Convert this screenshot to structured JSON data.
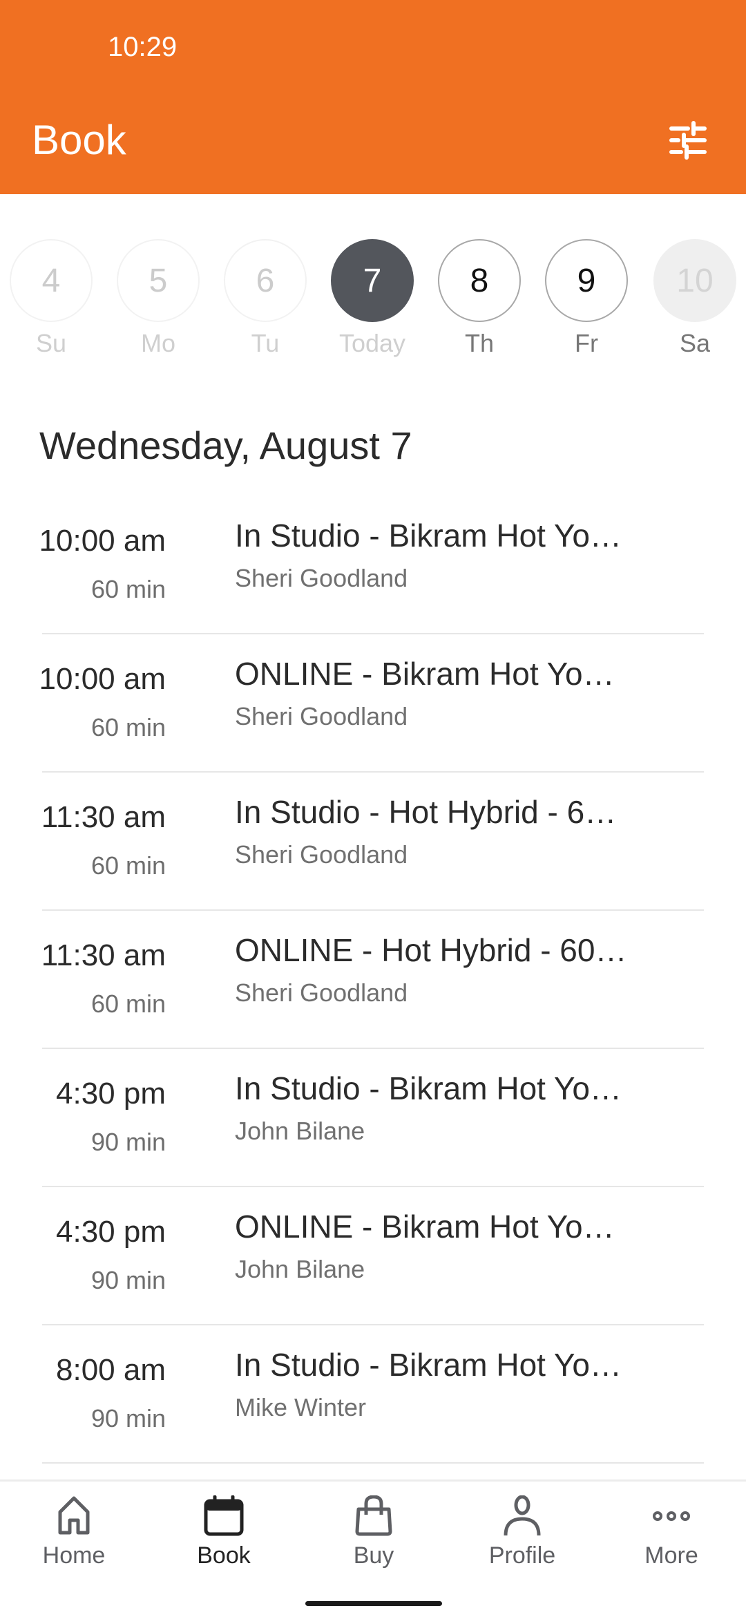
{
  "status_bar": {
    "time": "10:29"
  },
  "header": {
    "title": "Book",
    "filter_icon": "sliders-icon"
  },
  "colors": {
    "brand": "#f07022",
    "selected_day": "#53565c"
  },
  "week": [
    {
      "num": "4",
      "label": "Su",
      "state": "past"
    },
    {
      "num": "5",
      "label": "Mo",
      "state": "past"
    },
    {
      "num": "6",
      "label": "Tu",
      "state": "past"
    },
    {
      "num": "7",
      "label": "Today",
      "state": "today"
    },
    {
      "num": "8",
      "label": "Th",
      "state": "future"
    },
    {
      "num": "9",
      "label": "Fr",
      "state": "future"
    },
    {
      "num": "10",
      "label": "Sa",
      "state": "disabled"
    }
  ],
  "date_heading": "Wednesday, August 7",
  "classes": [
    {
      "time": "10:00 am",
      "duration": "60 min",
      "name": "In Studio - Bikram Hot Yo…",
      "instructor": "Sheri Goodland"
    },
    {
      "time": "10:00 am",
      "duration": "60 min",
      "name": "ONLINE - Bikram Hot Yo…",
      "instructor": "Sheri Goodland"
    },
    {
      "time": "11:30 am",
      "duration": "60 min",
      "name": "In Studio - Hot Hybrid - 6…",
      "instructor": "Sheri Goodland"
    },
    {
      "time": "11:30 am",
      "duration": "60 min",
      "name": "ONLINE - Hot Hybrid - 60…",
      "instructor": "Sheri Goodland"
    },
    {
      "time": "4:30 pm",
      "duration": "90 min",
      "name": "In Studio - Bikram Hot Yo…",
      "instructor": "John Bilane"
    },
    {
      "time": "4:30 pm",
      "duration": "90 min",
      "name": "ONLINE - Bikram Hot Yo…",
      "instructor": "John Bilane"
    },
    {
      "time": "8:00 am",
      "duration": "90 min",
      "name": "In Studio - Bikram Hot Yo…",
      "instructor": "Mike Winter"
    }
  ],
  "tabs": [
    {
      "label": "Home",
      "icon": "home-icon"
    },
    {
      "label": "Book",
      "icon": "calendar-icon",
      "active": true
    },
    {
      "label": "Buy",
      "icon": "shopping-bag-icon"
    },
    {
      "label": "Profile",
      "icon": "person-icon"
    },
    {
      "label": "More",
      "icon": "more-dots-icon"
    }
  ]
}
